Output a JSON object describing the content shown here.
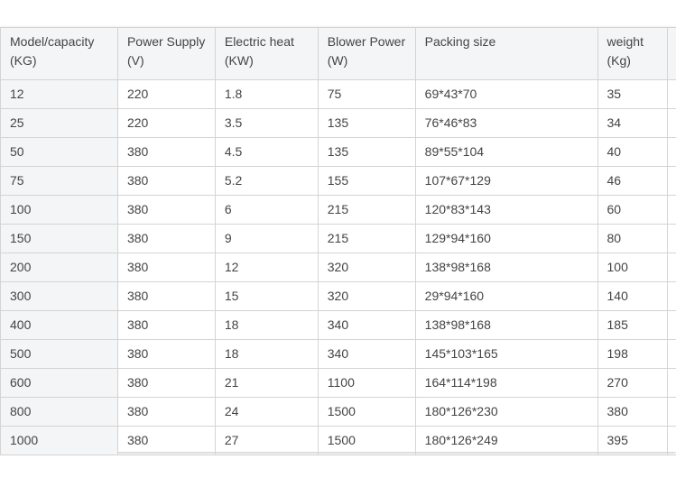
{
  "table": {
    "headers": [
      "Model/capacity\n  (KG)",
      "Power Supply\n(V)",
      "Electric heat\n(KW)",
      "Blower Power\n(W)",
      "Packing size",
      "weight\n(Kg)"
    ],
    "rows": [
      [
        "12",
        "220",
        "1.8",
        "75",
        "69*43*70",
        "35"
      ],
      [
        "25",
        "220",
        "3.5",
        "135",
        "76*46*83",
        "34"
      ],
      [
        "50",
        "380",
        "4.5",
        "135",
        "89*55*104",
        "40"
      ],
      [
        "75",
        "380",
        "5.2",
        "155",
        "107*67*129",
        "46"
      ],
      [
        "100",
        "380",
        "6",
        "215",
        "120*83*143",
        "60"
      ],
      [
        "150",
        "380",
        "9",
        "215",
        "129*94*160",
        "80"
      ],
      [
        "200",
        "380",
        "12",
        "320",
        "138*98*168",
        "100"
      ],
      [
        "300",
        "380",
        "15",
        "320",
        "29*94*160",
        "140"
      ],
      [
        "400",
        "380",
        "18",
        "340",
        "138*98*168",
        "185"
      ],
      [
        "500",
        "380",
        "18",
        "340",
        "145*103*165",
        "198"
      ],
      [
        "600",
        "380",
        "21",
        "1100",
        "164*114*198",
        "270"
      ],
      [
        "800",
        "380",
        "24",
        "1500",
        "180*126*230",
        "380"
      ],
      [
        "1000",
        "380",
        "27",
        "1500",
        "180*126*249",
        "395"
      ]
    ]
  }
}
